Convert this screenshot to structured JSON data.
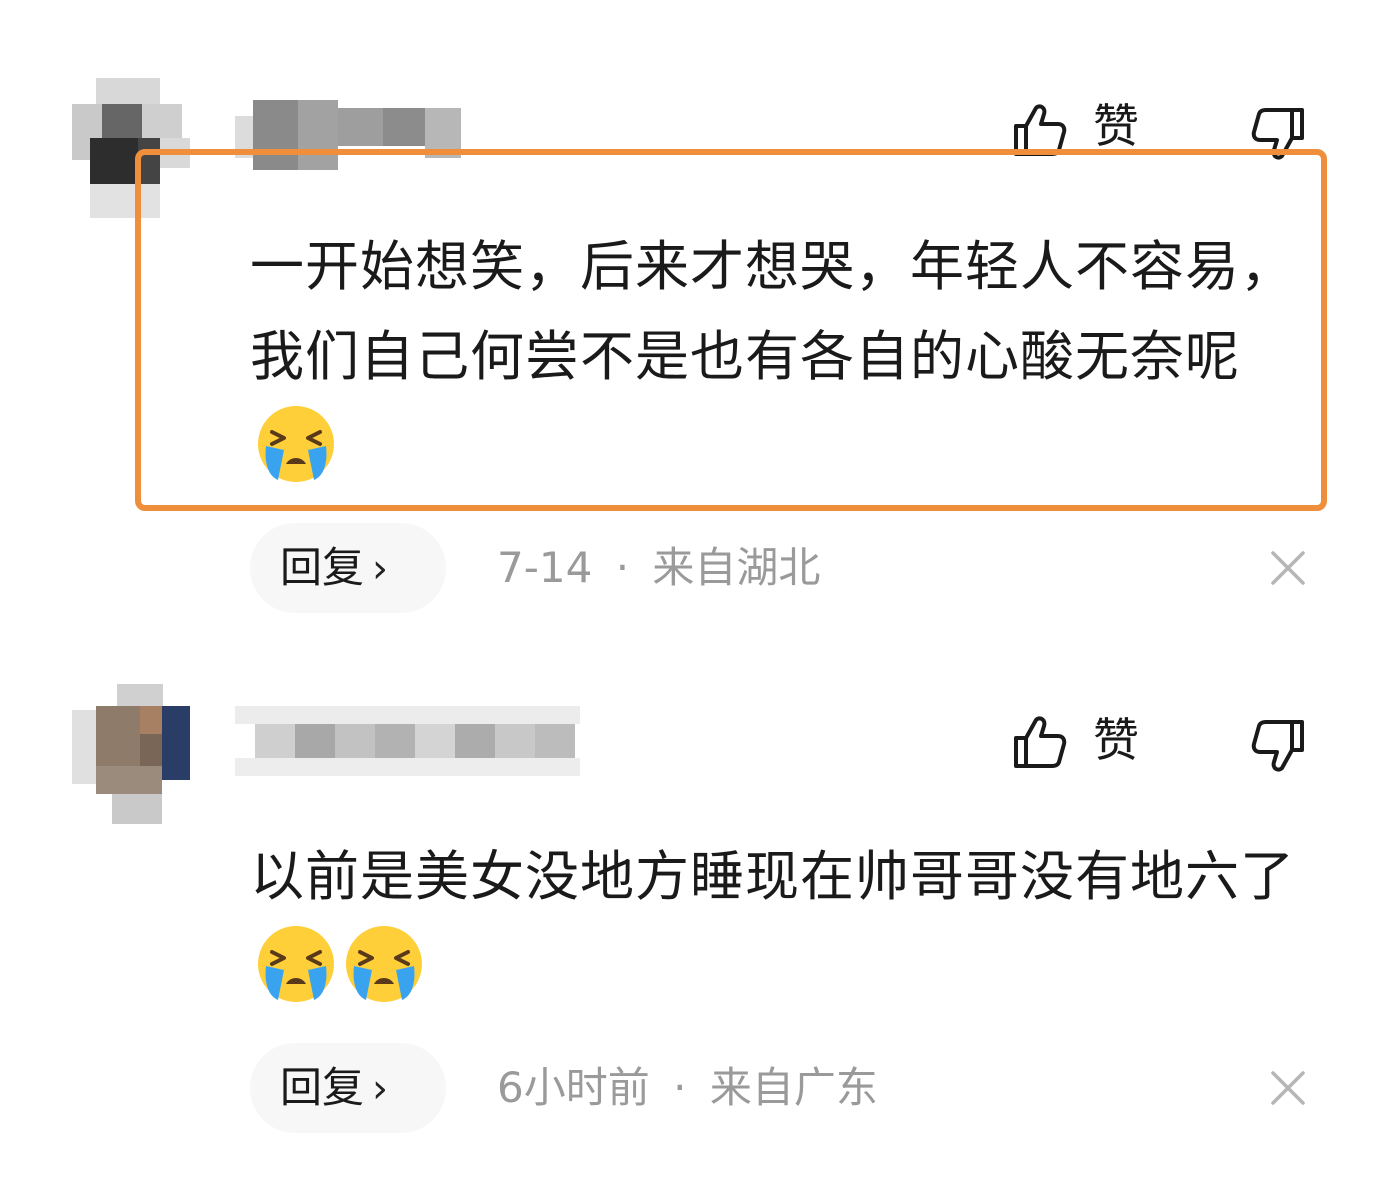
{
  "comments": [
    {
      "like_label": "赞",
      "text": "一开始想笑，后来才想哭，年轻人不容易，我们自己何尝不是也有各自的心酸无奈呢",
      "emoji_count": 1,
      "reply_label": "回复",
      "reply_chevron": "›",
      "date": "7-14",
      "separator": "·",
      "location": "来自湖北",
      "avatar_icon": "pixelated-avatar-icon",
      "username_icon": "pixelated-username-icon"
    },
    {
      "like_label": "赞",
      "text": "以前是美女没地方睡现在帅哥哥没有地六了",
      "emoji_count": 2,
      "reply_label": "回复",
      "reply_chevron": "›",
      "date": "6小时前",
      "separator": "·",
      "location": "来自广东",
      "avatar_icon": "pixelated-avatar-icon",
      "username_icon": "pixelated-username-icon"
    }
  ],
  "colors": {
    "highlight_border": "#ef8f3c",
    "meta_text": "#9a9a9a",
    "reply_bg": "#f7f7f7",
    "emoji_face": "#ffcf3a",
    "emoji_tears": "#3aa3f0"
  }
}
